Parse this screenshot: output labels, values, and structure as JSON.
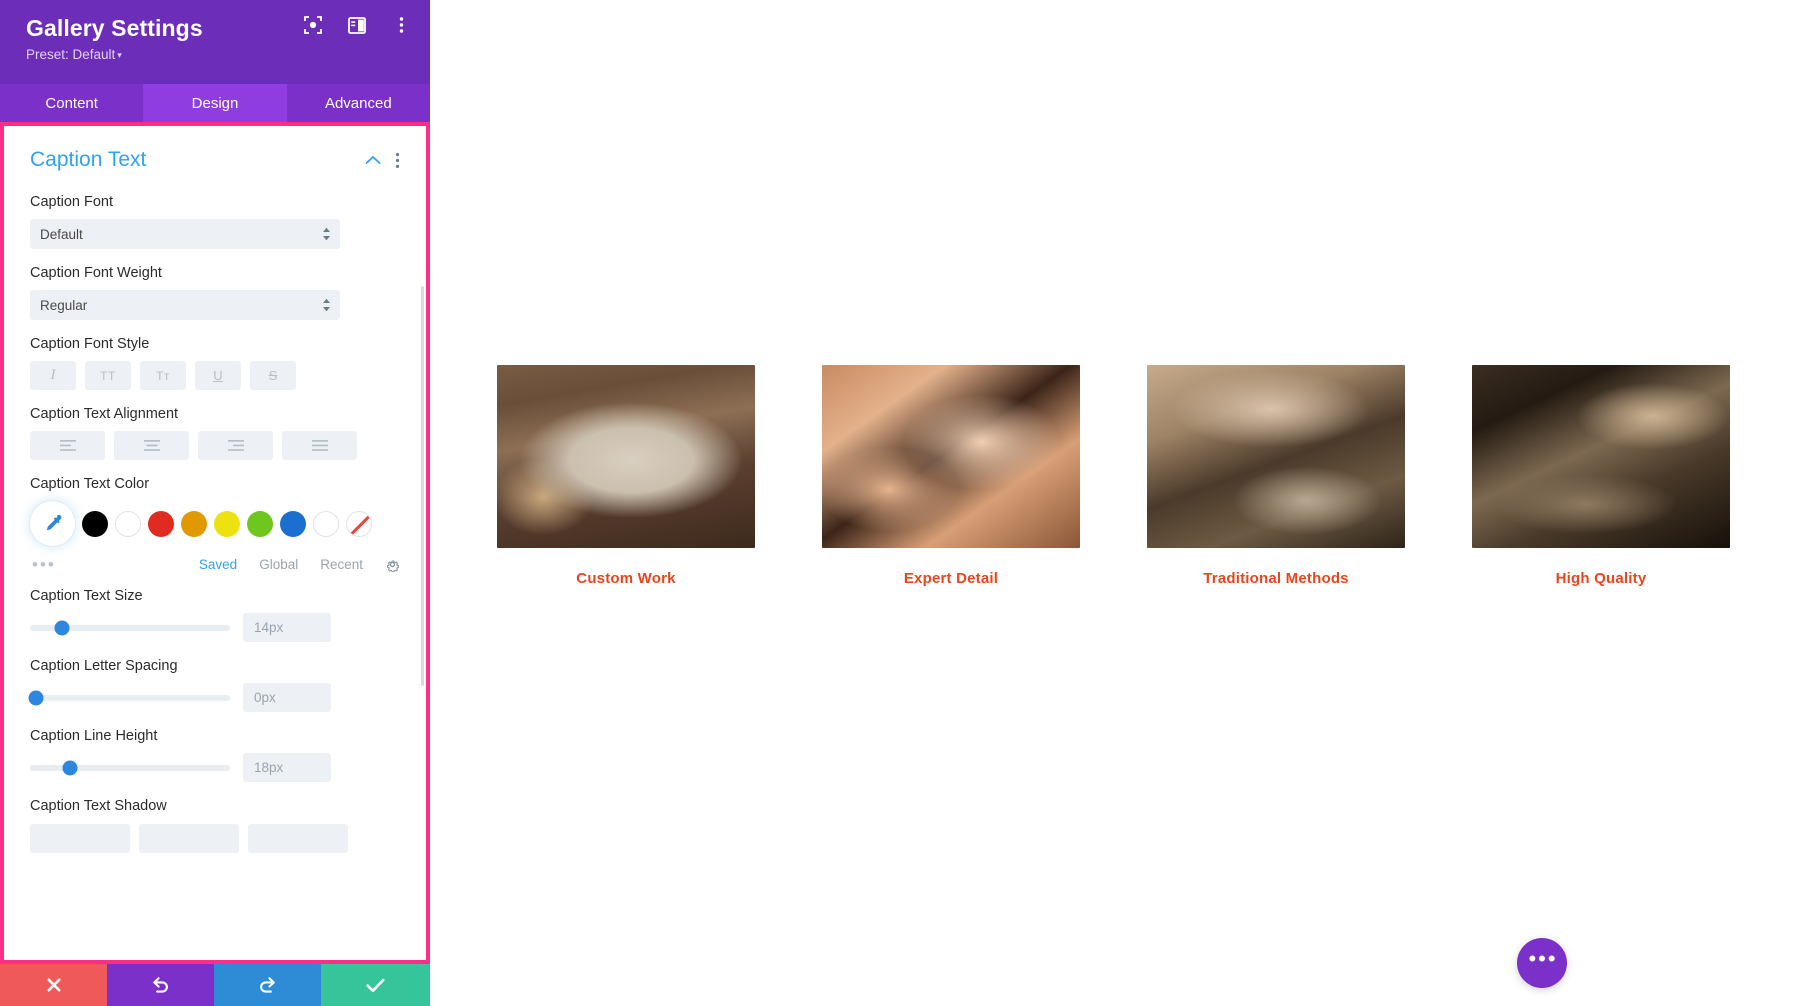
{
  "panel": {
    "title": "Gallery Settings",
    "preset_label": "Preset: Default",
    "preset_caret": "▾",
    "header_icons": [
      {
        "name": "focus-icon"
      },
      {
        "name": "panel-layout-icon"
      },
      {
        "name": "more-vertical-icon"
      }
    ],
    "tabs": [
      {
        "label": "Content",
        "active": false
      },
      {
        "label": "Design",
        "active": true
      },
      {
        "label": "Advanced",
        "active": false
      }
    ],
    "section": {
      "title": "Caption Text",
      "collapse_icon": "chevron-up-icon",
      "menu_icon": "more-vertical-icon"
    },
    "fields": {
      "caption_font": {
        "label": "Caption Font",
        "value": "Default"
      },
      "caption_font_weight": {
        "label": "Caption Font Weight",
        "value": "Regular"
      },
      "caption_font_style": {
        "label": "Caption Font Style",
        "buttons": [
          {
            "glyph": "I",
            "name": "italic"
          },
          {
            "glyph": "TT",
            "name": "uppercase"
          },
          {
            "glyph": "Tᴛ",
            "name": "small-caps"
          },
          {
            "glyph": "U",
            "name": "underline"
          },
          {
            "glyph": "S",
            "name": "strikethrough"
          }
        ]
      },
      "caption_text_alignment": {
        "label": "Caption Text Alignment",
        "buttons": [
          {
            "name": "align-left"
          },
          {
            "name": "align-center"
          },
          {
            "name": "align-right"
          },
          {
            "name": "align-justify"
          }
        ]
      },
      "caption_text_color": {
        "label": "Caption Text Color",
        "picker_icon": "eyedropper-icon",
        "swatches": [
          {
            "hex": "#000000",
            "name": "black"
          },
          {
            "hex": "#FFFFFF",
            "name": "white"
          },
          {
            "hex": "#E02B20",
            "name": "red"
          },
          {
            "hex": "#E09900",
            "name": "orange"
          },
          {
            "hex": "#EDE210",
            "name": "yellow"
          },
          {
            "hex": "#6EC61E",
            "name": "green"
          },
          {
            "hex": "#1B6FD0",
            "name": "blue"
          },
          {
            "hex": "#FFFFFF",
            "name": "white-outline"
          },
          {
            "hex": "transparent",
            "name": "no-color"
          }
        ],
        "more_dots": "•••",
        "tabs": [
          {
            "label": "Saved",
            "active": true
          },
          {
            "label": "Global",
            "active": false
          },
          {
            "label": "Recent",
            "active": false
          }
        ],
        "settings_icon": "gear-icon"
      },
      "caption_text_size": {
        "label": "Caption Text Size",
        "value": "14px",
        "knob_pct": 16
      },
      "caption_letter_spacing": {
        "label": "Caption Letter Spacing",
        "value": "0px",
        "knob_pct": 3
      },
      "caption_line_height": {
        "label": "Caption Line Height",
        "value": "18px",
        "knob_pct": 20
      },
      "caption_text_shadow": {
        "label": "Caption Text Shadow"
      }
    },
    "actions": [
      {
        "name": "cancel-button",
        "glyph": "✕",
        "color": "#F0595A"
      },
      {
        "name": "undo-button",
        "glyph": "↺",
        "color": "#7B30C9"
      },
      {
        "name": "redo-button",
        "glyph": "↻",
        "color": "#2E8BD6"
      },
      {
        "name": "save-button",
        "glyph": "✓",
        "color": "#36C49A"
      }
    ],
    "accent_border_color": "#FF2D87",
    "brand_purple": "#6C2EB9"
  },
  "gallery": {
    "items": [
      {
        "caption": "Custom Work",
        "art": "img1",
        "alt": "carved wooden chair crest"
      },
      {
        "caption": "Expert Detail",
        "art": "img2",
        "alt": "close-up wood shavings and carved leaves"
      },
      {
        "caption": "Traditional Methods",
        "art": "img3",
        "alt": "chisels and carving tools on workbench"
      },
      {
        "caption": "High Quality",
        "art": "img4",
        "alt": "hand plane on a workbench"
      }
    ],
    "caption_color": "#E8461E",
    "fab": {
      "name": "page-settings-fab",
      "glyph": "•••"
    }
  }
}
